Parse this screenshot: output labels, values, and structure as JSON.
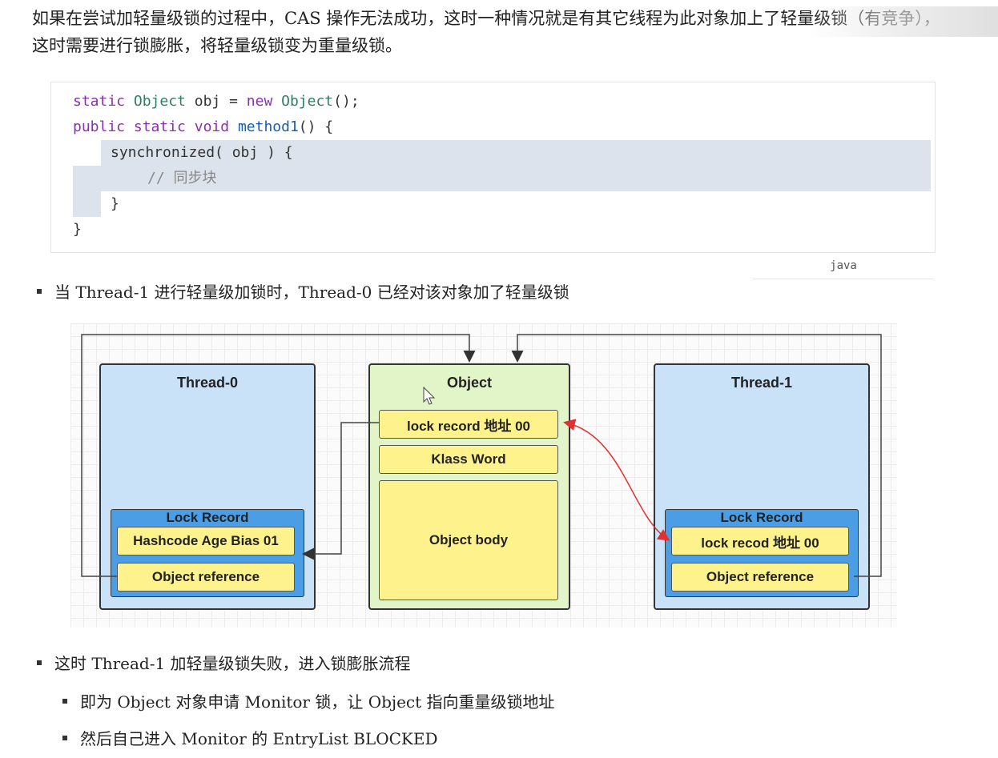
{
  "intro": "如果在尝试加轻量级锁的过程中，CAS 操作无法成功，这时一种情况就是有其它线程为此对象加上了轻量级锁（有竞争），这时需要进行锁膨胀，将轻量级锁变为重量级锁。",
  "code": {
    "line1": {
      "kw": "static",
      "type": "Object",
      "mid": " obj = ",
      "kw2": "new",
      "type2": "Object",
      "end": "();"
    },
    "line2": {
      "kw": "public static",
      "type": "void",
      "fn": "method1",
      "end": "() {"
    },
    "line3": "synchronized( obj ) {",
    "line4": "// 同步块",
    "line5": "}",
    "line6": "}",
    "lang": "java"
  },
  "bullets": {
    "b1": "当 Thread-1 进行轻量级加锁时，Thread-0 已经对该对象加了轻量级锁",
    "b2": "这时 Thread-1 加轻量级锁失败，进入锁膨胀流程",
    "b3": "即为 Object 对象申请 Monitor 锁，让 Object 指向重量级锁地址",
    "b4": "然后自己进入 Monitor 的 EntryList BLOCKED"
  },
  "diagram": {
    "thread0": {
      "title": "Thread-0",
      "lock_record_title": "Lock Record",
      "field1": "Hashcode Age Bias 01",
      "field2": "Object reference"
    },
    "object": {
      "title": "Object",
      "field1": "lock record 地址 00",
      "field2": "Klass Word",
      "field3": "Object body"
    },
    "thread1": {
      "title": "Thread-1",
      "lock_record_title": "Lock Record",
      "field1": "lock recod 地址 00",
      "field2": "Object reference"
    },
    "colors": {
      "thread_bg": "#c9e2f8",
      "object_bg": "#e2f5c8",
      "lock_record_bg": "#4b9de6",
      "field_bg": "#fdf28c",
      "cas_arrow": "#e03030"
    }
  }
}
